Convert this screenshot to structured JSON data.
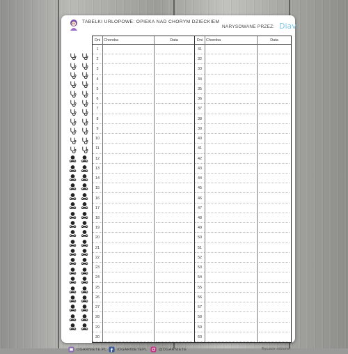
{
  "header": {
    "title": "TABELKI URLOPOWE: OPIEKA NAD CHORYM DZIECKIEM",
    "drawn_by": "NARYSOWANE PRZEZ:",
    "author": "Diav"
  },
  "table": {
    "day_header": "Dni",
    "illness_header": "Choroba",
    "date_header": "Data",
    "left_days": [
      "1",
      "2",
      "3",
      "4",
      "5",
      "6",
      "7",
      "8",
      "9",
      "10",
      "11",
      "12",
      "13",
      "14",
      "15",
      "16",
      "17",
      "18",
      "19",
      "20",
      "21",
      "22",
      "23",
      "24",
      "25",
      "26",
      "27",
      "28",
      "29",
      "30"
    ],
    "right_days": [
      "31",
      "32",
      "33",
      "34",
      "35",
      "36",
      "37",
      "38",
      "39",
      "40",
      "41",
      "42",
      "43",
      "44",
      "45",
      "46",
      "47",
      "48",
      "49",
      "50",
      "51",
      "52",
      "53",
      "54",
      "55",
      "56",
      "57",
      "58",
      "59",
      "60"
    ]
  },
  "sidebar_icons": {
    "outline_rows": 11,
    "filled_rows": 19,
    "outline_icon": "stethoscope-icon",
    "filled_icon": "sick-child-icon"
  },
  "footer": {
    "site": "OGARNIETE.PL",
    "facebook": "/OGARNIETEPL",
    "instagram": "@OGARNIETE",
    "note": "Ręcznie robione!"
  },
  "colors": {
    "accent": "#7fc6e6",
    "mascot": "#7b4fa3",
    "line": "#333333"
  }
}
